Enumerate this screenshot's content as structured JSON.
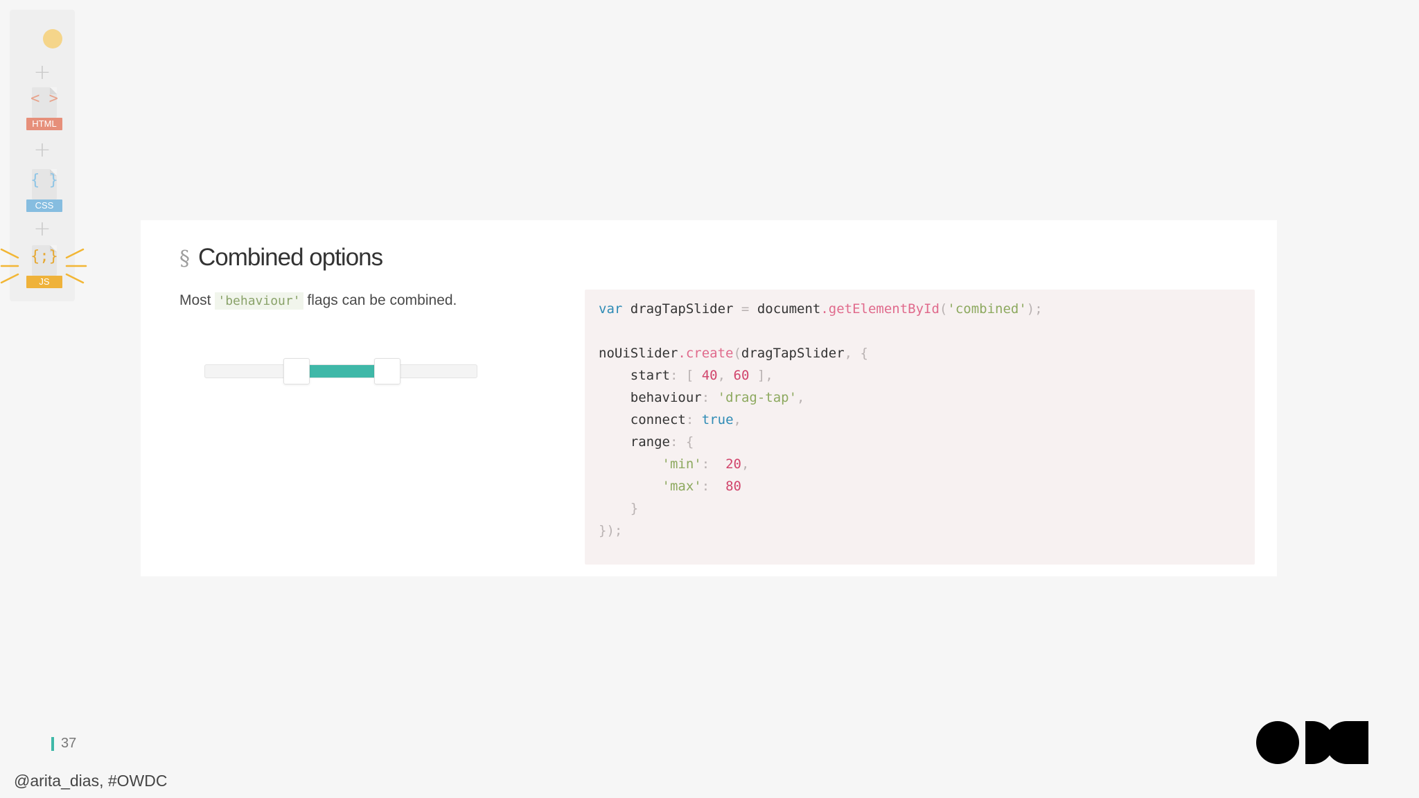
{
  "sidebar": {
    "files": [
      {
        "glyph": "< >",
        "tag": "HTML",
        "glyph_color": "#e8a28a",
        "tag_color": "#e68f7a"
      },
      {
        "glyph": "{ }",
        "tag": "CSS",
        "glyph_color": "#8ec5e6",
        "tag_color": "#86bde0"
      },
      {
        "glyph": "{;}",
        "tag": "JS",
        "glyph_color": "#e6a831",
        "tag_color": "#efb23a"
      }
    ],
    "active_file": "JS",
    "accent_colors": {
      "dot": "#f5d58a",
      "rays": "#f2b634"
    }
  },
  "section": {
    "mark": "§",
    "title": "Combined options",
    "description_prefix": "Most",
    "description_code": "'behaviour'",
    "description_suffix": "flags can be combined."
  },
  "slider": {
    "range": [
      20,
      80
    ],
    "start": [
      40,
      60
    ],
    "connect_color": "#3fb8a8"
  },
  "code_lines": [
    "var dragTapSlider = document.getElementById('combined');",
    "",
    "noUiSlider.create(dragTapSlider, {",
    "    start: [ 40, 60 ],",
    "    behaviour: 'drag-tap',",
    "    connect: true,",
    "    range: {",
    "        'min':  20,",
    "        'max':  80",
    "    }",
    "});"
  ],
  "footer": {
    "page_number": "37",
    "handle": "@arita_dias, #OWDC",
    "accent": "#3fb8a8"
  }
}
